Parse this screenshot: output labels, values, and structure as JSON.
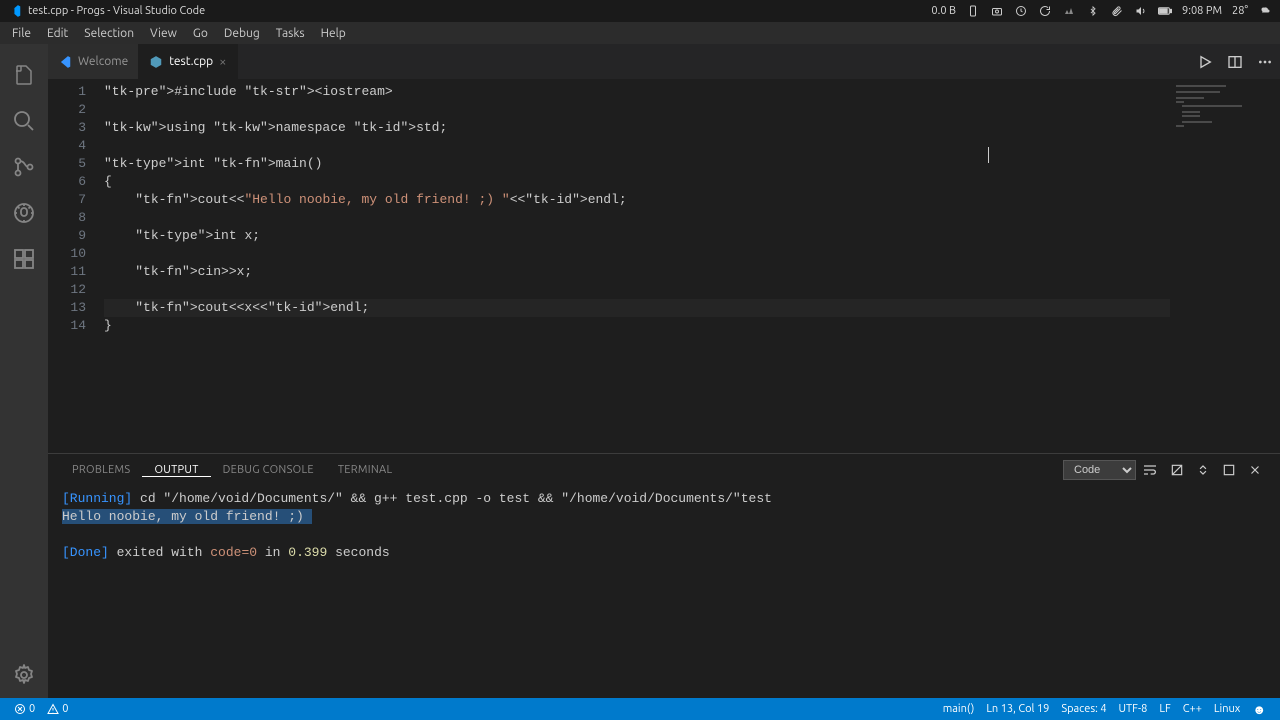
{
  "window": {
    "title": "test.cpp - Progs - Visual Studio Code"
  },
  "system_tray": {
    "net_speed": "0.0 B",
    "time": "9:08 PM",
    "temp": "28°"
  },
  "menu": [
    "File",
    "Edit",
    "Selection",
    "View",
    "Go",
    "Debug",
    "Tasks",
    "Help"
  ],
  "tabs": [
    {
      "label": "Welcome",
      "active": false
    },
    {
      "label": "test.cpp",
      "active": true
    }
  ],
  "editor": {
    "line_numbers": [
      "1",
      "2",
      "3",
      "4",
      "5",
      "6",
      "7",
      "8",
      "9",
      "10",
      "11",
      "12",
      "13",
      "14"
    ],
    "current_line": 13,
    "source_raw": "#include <iostream>\n\nusing namespace std;\n\nint main()\n{\n    cout<<\"Hello noobie, my old friend! ;) \"<<endl;\n\n    int x;\n\n    cin>>x;\n\n    cout<<x<<endl;\n}"
  },
  "panel": {
    "tabs": [
      "PROBLEMS",
      "OUTPUT",
      "DEBUG CONSOLE",
      "TERMINAL"
    ],
    "active_tab": "OUTPUT",
    "channel": "Code",
    "output": {
      "running_label": "[Running]",
      "running_cmd": " cd \"/home/void/Documents/\" && g++ test.cpp -o test && \"/home/void/Documents/\"test",
      "program_output": "Hello noobie, my old friend! ;) ",
      "done_label": "[Done]",
      "done_text_1": " exited with ",
      "done_code": "code=0",
      "done_text_2": " in ",
      "done_time": "0.399",
      "done_text_3": " seconds"
    }
  },
  "statusbar": {
    "errors": "0",
    "warnings": "0",
    "scope": "main()",
    "position": "Ln 13, Col 19",
    "spaces": "Spaces: 4",
    "encoding": "UTF-8",
    "eol": "LF",
    "language": "C++",
    "os": "Linux"
  }
}
